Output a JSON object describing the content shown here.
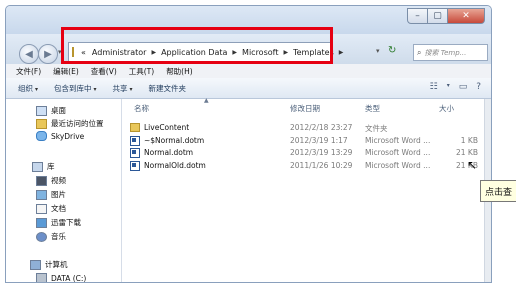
{
  "window": {
    "buttons": {
      "min": "–",
      "max": "▢",
      "close": "✕"
    }
  },
  "navbar": {
    "back_icon": "◀",
    "fwd_icon": "▶",
    "dropdown_icon": "▾",
    "address": {
      "overflow": "«",
      "crumbs": [
        "Administrator",
        "Application Data",
        "Microsoft",
        "Templates"
      ],
      "separator": "▶"
    },
    "refresh_icon": "↻",
    "search_placeholder": "搜索 Temp..."
  },
  "menubar": {
    "items": [
      "文件(F)",
      "编辑(E)",
      "查看(V)",
      "工具(T)",
      "帮助(H)"
    ]
  },
  "toolbar": {
    "organize": "组织",
    "include_library": "包含到库中",
    "share": "共享",
    "new_folder": "新建文件夹",
    "dd": "▾"
  },
  "nav": {
    "favorites": [
      {
        "label": "桌面",
        "icon": "desktop-icon"
      },
      {
        "label": "最近访问的位置",
        "icon": "recent-places-icon"
      },
      {
        "label": "SkyDrive",
        "icon": "skydrive-icon"
      }
    ],
    "library_header": "库",
    "libraries": [
      {
        "label": "视频",
        "icon": "video-icon"
      },
      {
        "label": "图片",
        "icon": "pictures-icon"
      },
      {
        "label": "文档",
        "icon": "documents-icon"
      },
      {
        "label": "迅雷下载",
        "icon": "download-icon"
      },
      {
        "label": "音乐",
        "icon": "music-icon"
      }
    ],
    "computer_header": "计算机",
    "drive": "DATA (C:)"
  },
  "columns": {
    "name": "名称",
    "date": "修改日期",
    "type": "类型",
    "size": "大小"
  },
  "files": [
    {
      "name": "LiveContent",
      "date": "2012/2/18 23:27",
      "type": "文件夹",
      "size": "",
      "icon": "folder-icon"
    },
    {
      "name": "~$Normal.dotm",
      "date": "2012/3/19 1:17",
      "type": "Microsoft Word ...",
      "size": "1 KB",
      "icon": "word-template-icon"
    },
    {
      "name": "Normal.dotm",
      "date": "2012/3/19 13:29",
      "type": "Microsoft Word ...",
      "size": "21 KB",
      "icon": "word-template-icon"
    },
    {
      "name": "NormalOld.dotm",
      "date": "2011/1/26 10:29",
      "type": "Microsoft Word ...",
      "size": "21 KB",
      "icon": "word-template-icon"
    }
  ],
  "tooltip": "点击查"
}
